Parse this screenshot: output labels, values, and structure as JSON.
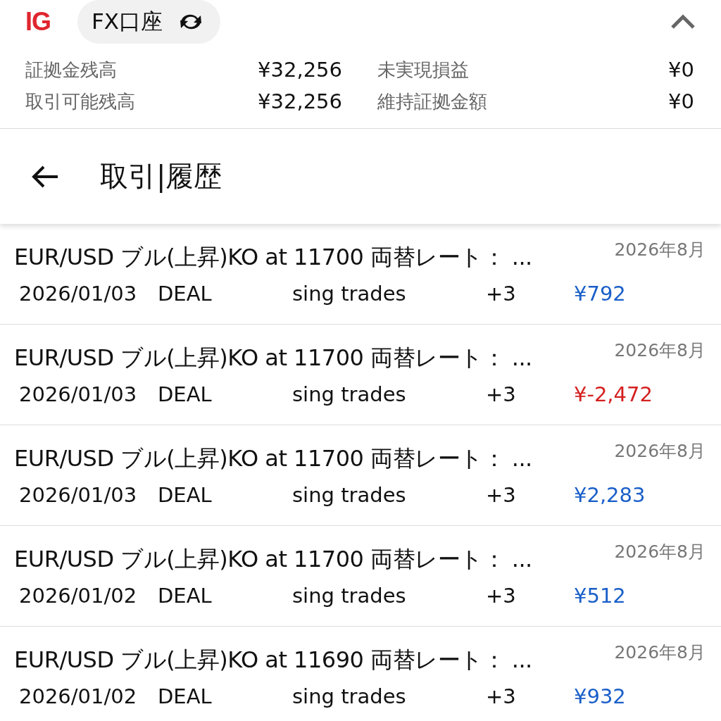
{
  "header": {
    "logo": "IG",
    "account": "FX口座"
  },
  "summary": [
    {
      "label": "証拠金残高",
      "value": "¥32,256"
    },
    {
      "label": "未実現損益",
      "value": "¥0"
    },
    {
      "label": "取引可能残高",
      "value": "¥32,256"
    },
    {
      "label": "維持証拠金額",
      "value": "¥0"
    }
  ],
  "page_title": "取引|履歴",
  "rows": [
    {
      "title": "EUR/USD ブル(上昇)KO at 11700 両替レート： ...",
      "month": "2026年8月",
      "date": "2026/01/03",
      "type": "DEAL",
      "desc": "sing trades",
      "count": "+3",
      "amount": "¥792",
      "kind": "gain"
    },
    {
      "title": "EUR/USD ブル(上昇)KO at 11700 両替レート： ...",
      "month": "2026年8月",
      "date": "2026/01/03",
      "type": "DEAL",
      "desc": "sing trades",
      "count": "+3",
      "amount": "¥-2,472",
      "kind": "loss"
    },
    {
      "title": "EUR/USD ブル(上昇)KO at 11700 両替レート： ...",
      "month": "2026年8月",
      "date": "2026/01/03",
      "type": "DEAL",
      "desc": "sing trades",
      "count": "+3",
      "amount": "¥2,283",
      "kind": "gain"
    },
    {
      "title": "EUR/USD ブル(上昇)KO at 11700 両替レート： ...",
      "month": "2026年8月",
      "date": "2026/01/02",
      "type": "DEAL",
      "desc": "sing trades",
      "count": "+3",
      "amount": "¥512",
      "kind": "gain"
    },
    {
      "title": "EUR/USD ブル(上昇)KO at 11690 両替レート： ...",
      "month": "2026年8月",
      "date": "2026/01/02",
      "type": "DEAL",
      "desc": "sing trades",
      "count": "+3",
      "amount": "¥932",
      "kind": "gain"
    }
  ]
}
